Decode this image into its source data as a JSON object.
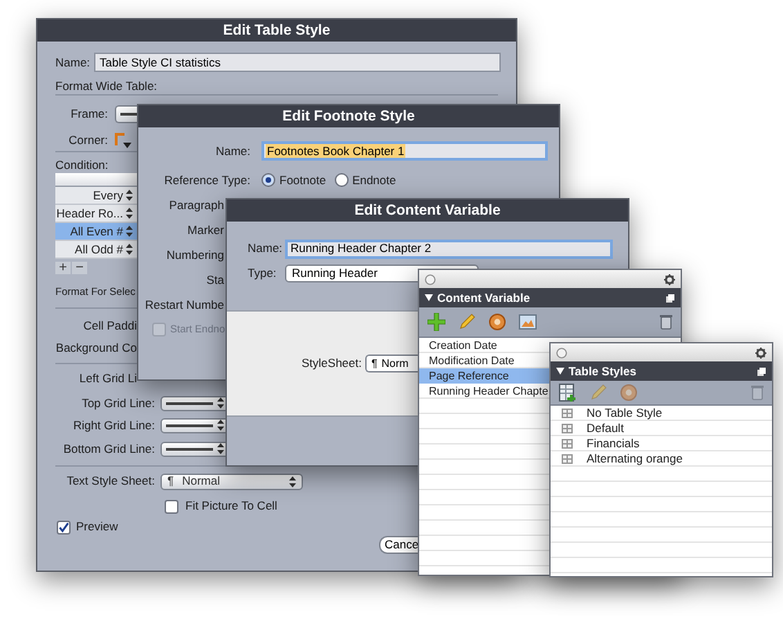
{
  "edit_table_style": {
    "title": "Edit Table Style",
    "name_label": "Name:",
    "name_value": "Table Style CI statistics",
    "section_label": "Format Wide Table:",
    "frame_label": "Frame:",
    "corner_label": "Corner:",
    "condition_label": "Condition:",
    "conditions": [
      {
        "label": "Every",
        "selected": false
      },
      {
        "label": "Header Ro...",
        "selected": false
      },
      {
        "label": "All Even #",
        "selected": true
      },
      {
        "label": "All Odd #",
        "selected": false
      }
    ],
    "add_button": "+",
    "remove_button": "−",
    "selection_label": "Format For Selec",
    "cell_labels": [
      "Cell Paddi",
      "Background Co"
    ],
    "grid_lines": [
      {
        "label": "Left Grid Li",
        "kind": "cut"
      },
      {
        "label": "Top Grid Line:",
        "kind": "line"
      },
      {
        "label": "Right Grid Line:",
        "kind": "line"
      },
      {
        "label": "Bottom Grid Line:",
        "kind": "line"
      }
    ],
    "text_style_sheet": {
      "label": "Text Style Sheet:",
      "glyph": "¶",
      "value": "Normal"
    },
    "fit_picture": {
      "label": "Fit Picture To Cell",
      "checked": false
    },
    "preview": {
      "label": "Preview",
      "checked": true
    },
    "cancel_button": "Cance"
  },
  "edit_footnote_style": {
    "title": "Edit Footnote Style",
    "name_label": "Name:",
    "name_value": "Footnotes Book Chapter 1",
    "name_highlighted": true,
    "reference_label": "Reference Type:",
    "reference_types": [
      {
        "label": "Footnote",
        "selected": true
      },
      {
        "label": "Endnote",
        "selected": false
      }
    ],
    "labels": [
      "Paragraph",
      "Marker",
      "Numbering",
      "Sta",
      "Restart Numbe"
    ],
    "start_endnote": {
      "label": "Start Endno",
      "checked": false,
      "disabled": true
    }
  },
  "edit_content_variable": {
    "title": "Edit Content Variable",
    "name_label": "Name:",
    "name_value": "Running Header Chapter 2",
    "type_label": "Type:",
    "type_value": "Running Header",
    "stylesheet_label": "StyleSheet:",
    "stylesheet_glyph": "¶",
    "stylesheet_value": "Norm"
  },
  "content_variable_palette": {
    "title": "Content Variable",
    "items": [
      {
        "label": "Creation Date",
        "selected": false
      },
      {
        "label": "Modification Date",
        "selected": false
      },
      {
        "label": "Page Reference",
        "selected": true
      },
      {
        "label": "Running Header Chapte",
        "selected": false
      }
    ]
  },
  "table_styles_palette": {
    "title": "Table Styles",
    "items": [
      {
        "label": "No Table Style",
        "selected": false
      },
      {
        "label": "Default",
        "selected": false
      },
      {
        "label": "Financials",
        "selected": false
      },
      {
        "label": "Alternating orange",
        "selected": false
      }
    ]
  }
}
